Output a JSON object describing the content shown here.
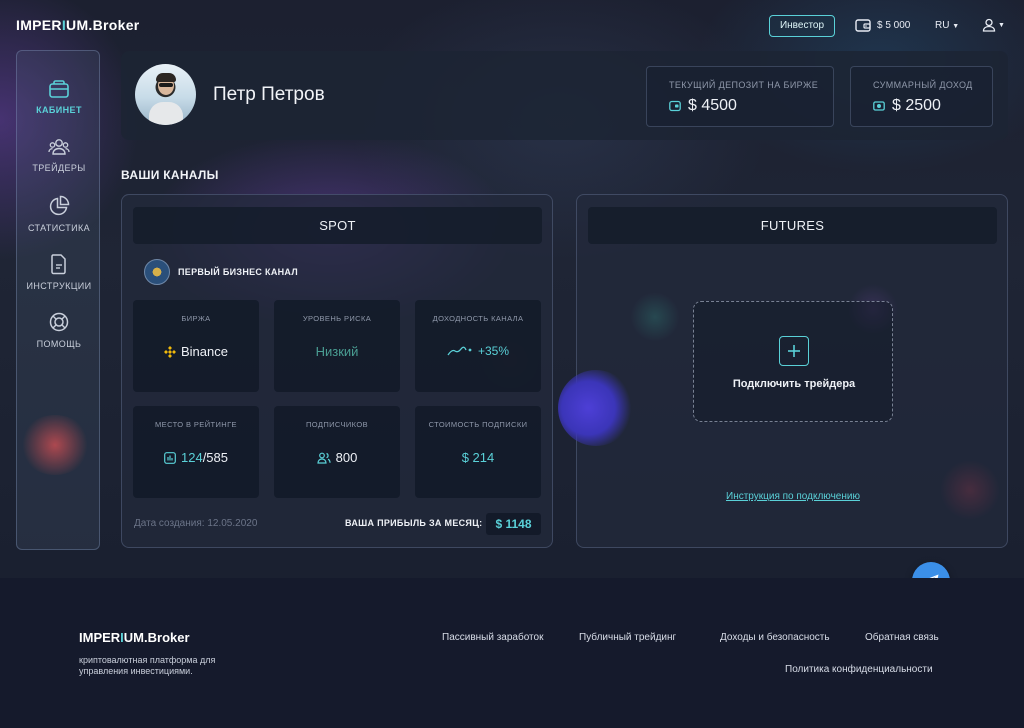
{
  "header": {
    "logo_pre": "IMPER",
    "logo_dot": "I",
    "logo_post": "UM",
    "logo_suffix": ".Broker",
    "investor_label": "Инвестор",
    "balance": "$ 5 000",
    "language": "RU"
  },
  "sidebar": {
    "items": [
      {
        "label": "КАБИНЕТ",
        "icon": "wallet-icon",
        "active": true
      },
      {
        "label": "ТРЕЙДЕРЫ",
        "icon": "users-icon",
        "active": false
      },
      {
        "label": "СТАТИСТИКА",
        "icon": "pie-chart-icon",
        "active": false
      },
      {
        "label": "ИНСТРУКЦИИ",
        "icon": "document-icon",
        "active": false
      },
      {
        "label": "ПОМОЩЬ",
        "icon": "lifebuoy-icon",
        "active": false
      }
    ]
  },
  "profile": {
    "name": "Петр Петров",
    "deposit_title": "ТЕКУЩИЙ ДЕПОЗИТ НА БИРЖЕ",
    "deposit_value": "$ 4500",
    "income_title": "СУММАРНЫЙ ДОХОД",
    "income_value": "$ 2500"
  },
  "channels": {
    "section_title": "ВАШИ КАНАЛЫ",
    "spot": {
      "title": "SPOT",
      "channel_name": "ПЕРВЫЙ БИЗНЕС КАНАЛ",
      "tiles": [
        {
          "title": "БИРЖА",
          "value": "Binance"
        },
        {
          "title": "УРОВЕНЬ РИСКА",
          "value": "Низкий"
        },
        {
          "title": "ДОХОДНОСТЬ КАНАЛА",
          "value": "+35%"
        },
        {
          "title": "МЕСТО В РЕЙТИНГЕ",
          "value_main": "124",
          "value_rest": "/585"
        },
        {
          "title": "ПОДПИСЧИКОВ",
          "value": "800"
        },
        {
          "title": "СТОИМОСТЬ ПОДПИСКИ",
          "value": "$ 214"
        }
      ],
      "created": "Дата создания: 12.05.2020",
      "profit_label": "ВАША ПРИБЫЛЬ ЗА МЕСЯЦ:",
      "profit_value": "$ 1148"
    },
    "futures": {
      "title": "FUTURES",
      "connect_label": "Подключить трейдера",
      "instruction_link": "Инструкция по подключению"
    }
  },
  "footer": {
    "logo_pre": "IMPER",
    "logo_dot": "I",
    "logo_post": "UM",
    "logo_suffix": ".Broker",
    "description": "криптовалютная платформа для управления инвестициями.",
    "links": [
      "Пассивный заработок",
      "Публичный трейдинг",
      "Доходы и безопасность",
      "Обратная связь",
      "Политика конфиденциальности"
    ]
  },
  "colors": {
    "accent": "#5ad1d8",
    "background": "#161a2b",
    "telegram": "#3b8fe8",
    "binance": "#f0b90b"
  }
}
